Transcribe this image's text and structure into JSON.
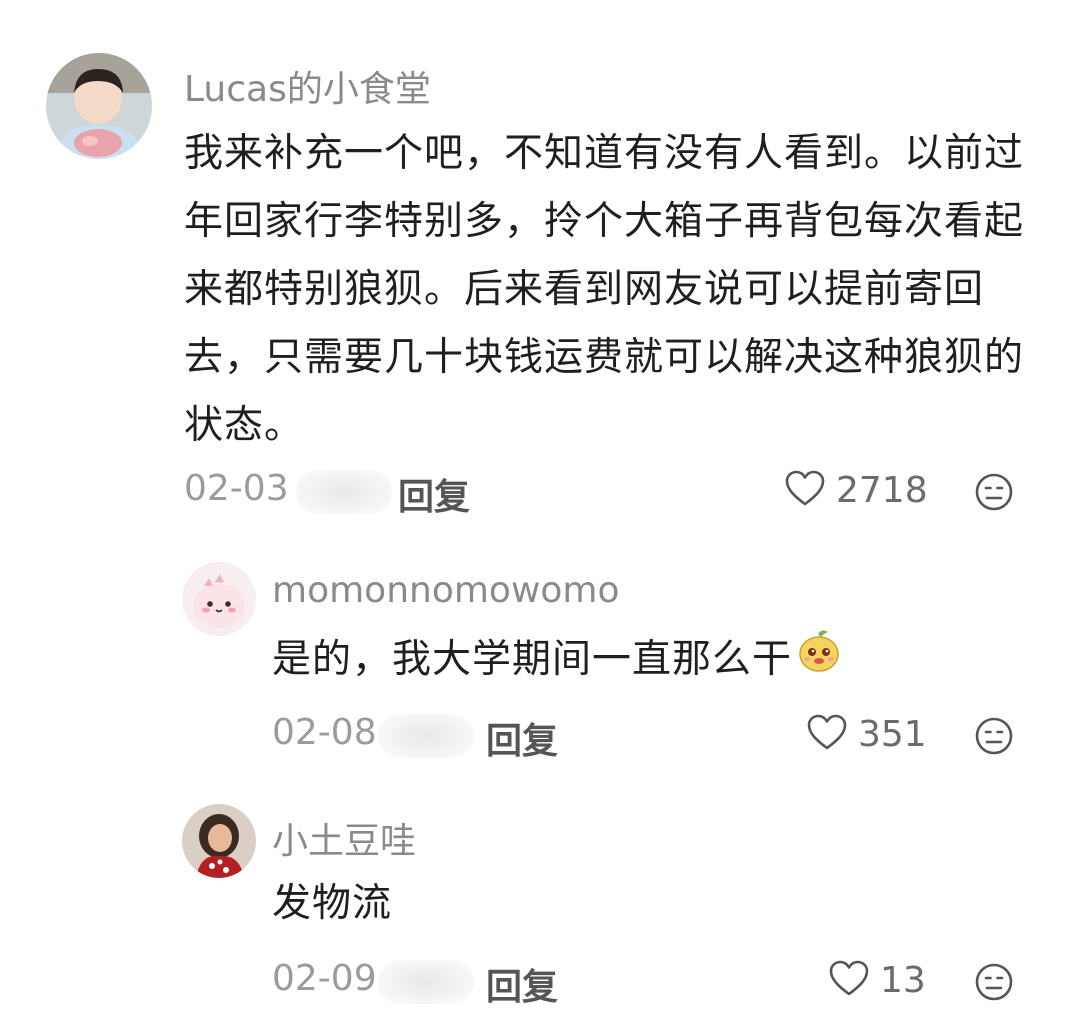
{
  "comments": [
    {
      "username": "Lucas的小食堂",
      "content": "我来补充一个吧，不知道有没有人看到。以前过年回家行李特别多，拎个大箱子再背包每次看起来都特别狼狈。后来看到网友说可以提前寄回去，只需要几十块钱运费就可以解决这种狼狈的状态。",
      "date": "02-03",
      "reply_label": "回复",
      "like_count": "2718"
    },
    {
      "username": "momonnomowomo",
      "content": "是的，我大学期间一直那么干",
      "date": "02-08",
      "reply_label": "回复",
      "like_count": "351"
    },
    {
      "username": "小土豆哇",
      "content": "发物流",
      "date": "02-09",
      "reply_label": "回复",
      "like_count": "13"
    }
  ],
  "icons": {
    "like": "heart-outline-icon",
    "dislike": "neutral-face-icon",
    "emoji": "cute-potato-emoji"
  },
  "colors": {
    "username": "#8a8a8a",
    "content": "#1f1f1f",
    "meta": "#9b9b9b",
    "icon": "#555555"
  }
}
